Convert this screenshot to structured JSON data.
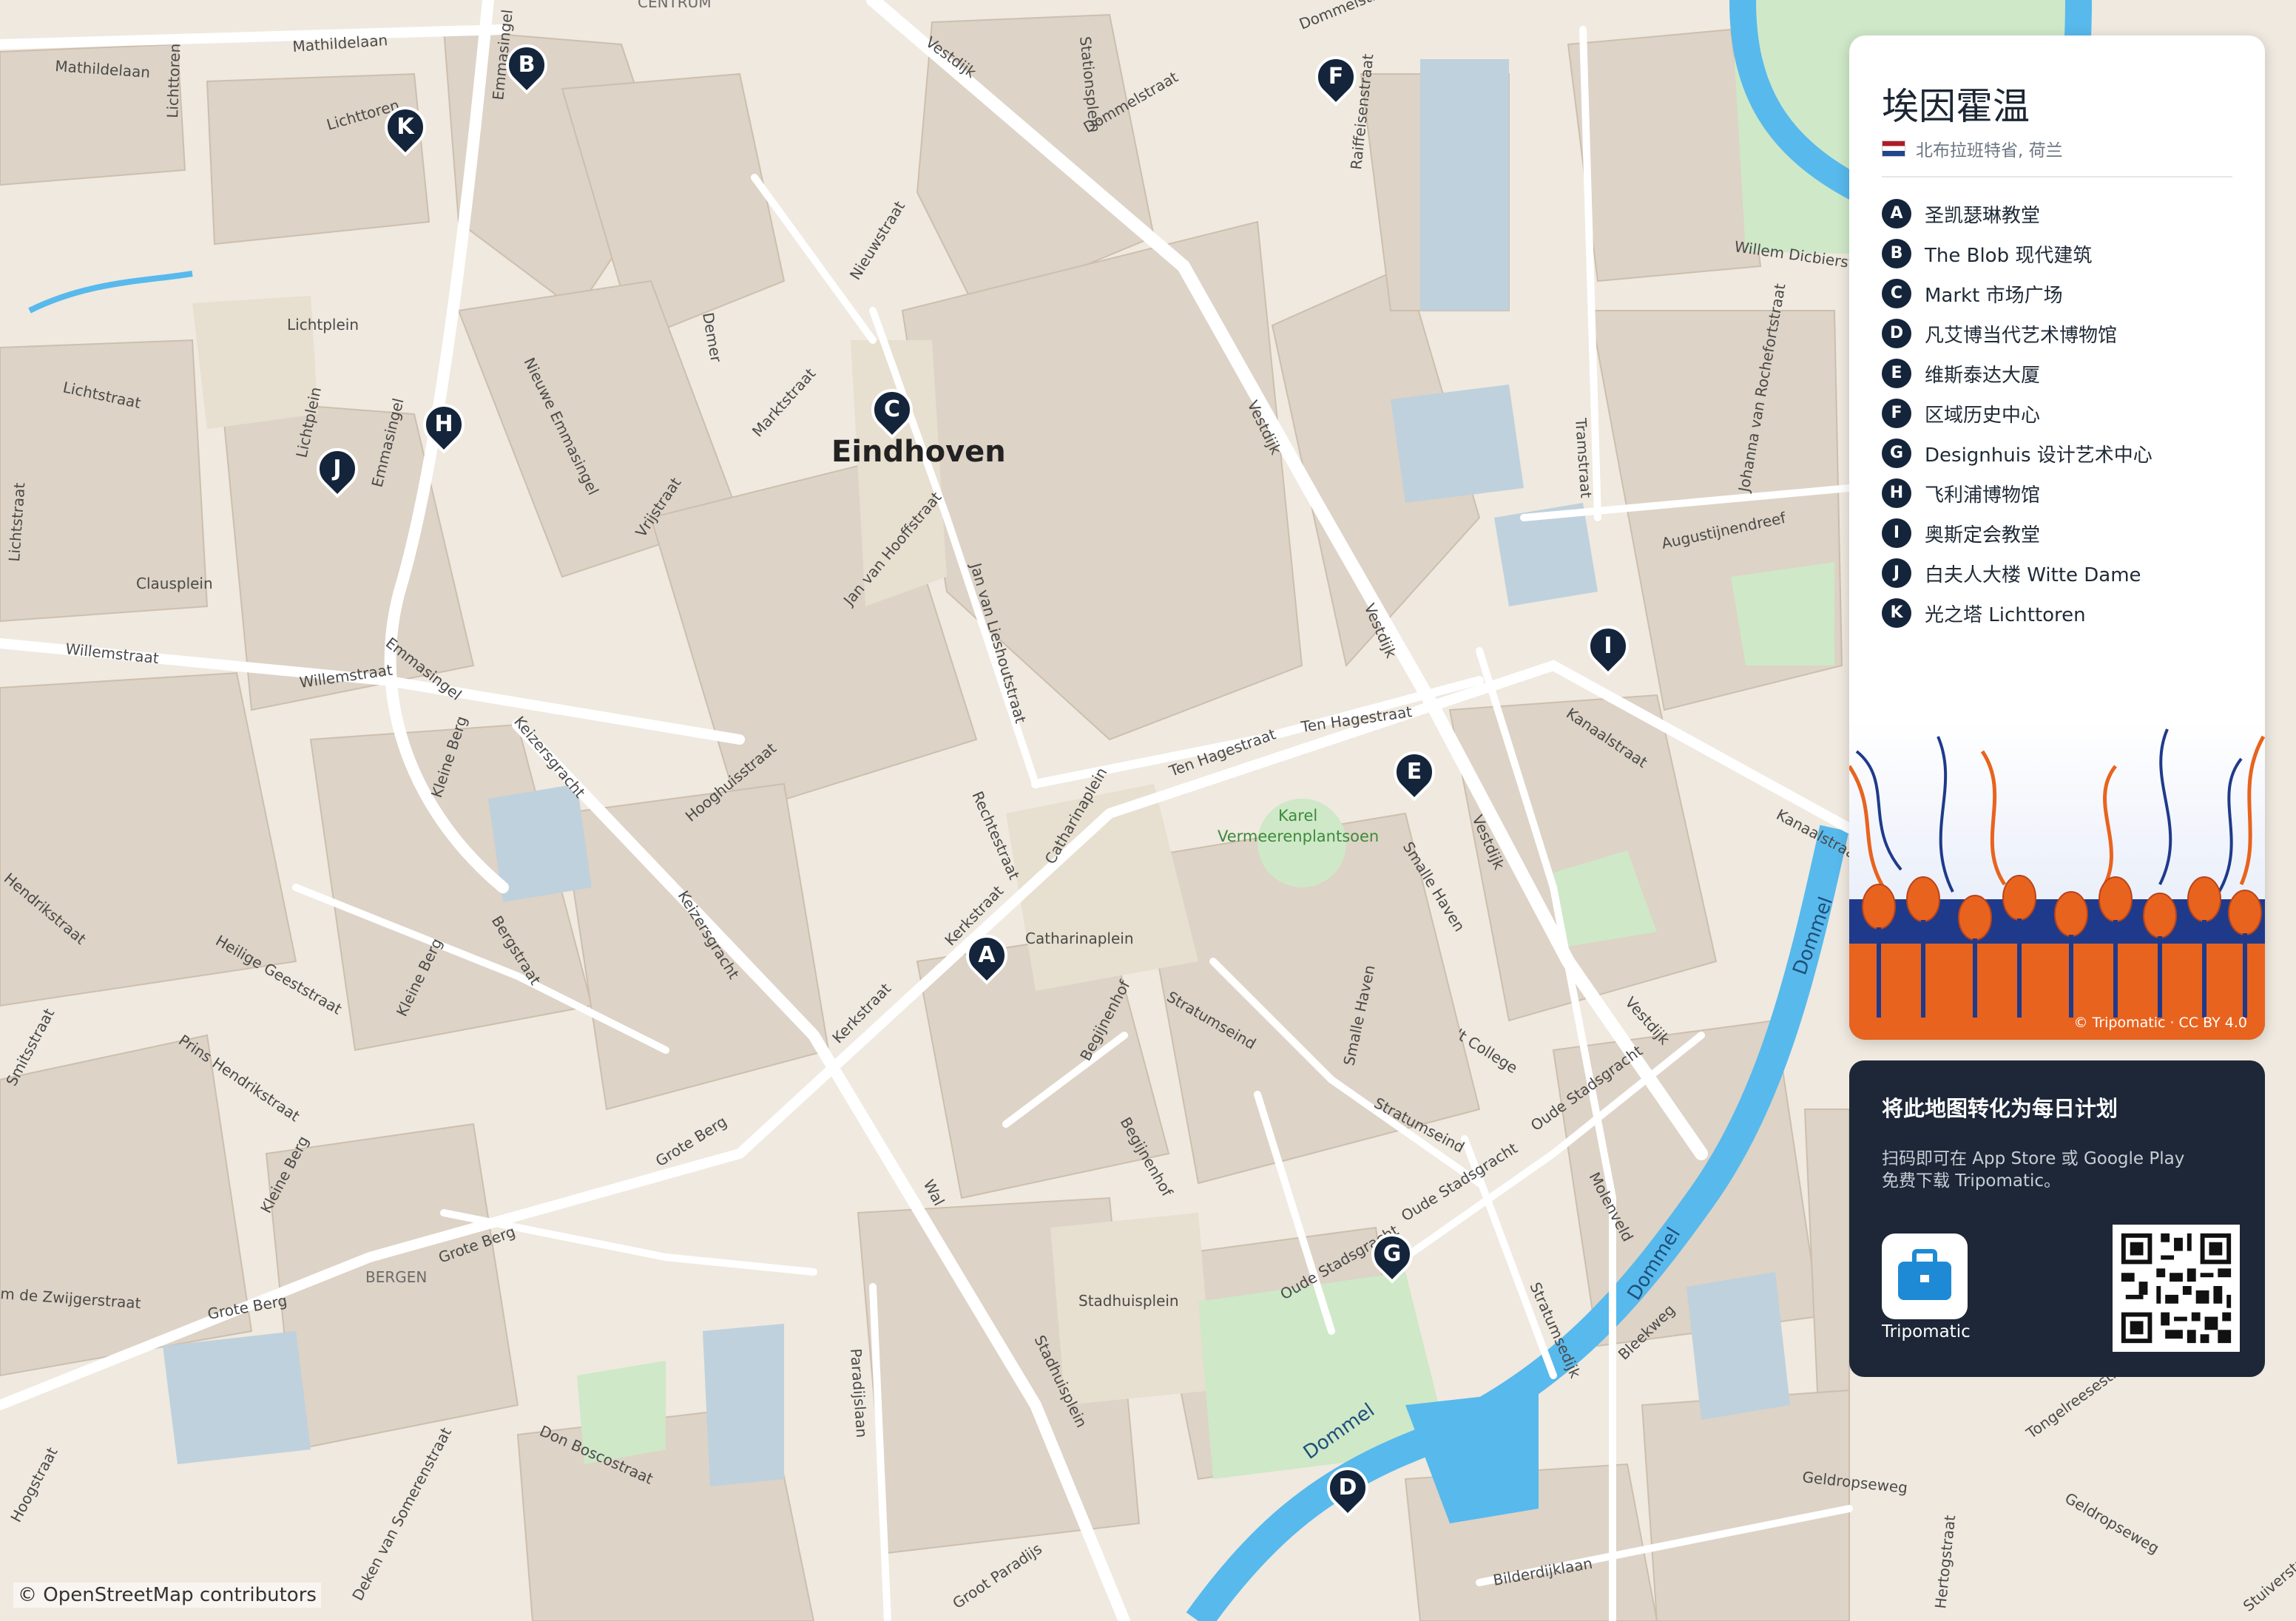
{
  "map": {
    "city_label": "Eindhoven",
    "attribution": "© OpenStreetMap contributors",
    "area_labels": [
      "CENTRUM",
      "BERGEN"
    ],
    "place_labels": [
      "Lichtplein",
      "Clausplein",
      "Karel",
      "Vermeerenplantsoen",
      "Catharinaplein",
      "Stadhuisplein"
    ],
    "water_labels": [
      "Dommel",
      "Dommel",
      "Dommel"
    ],
    "street_labels": [
      "Mathildelaan",
      "Mathildelaan",
      "Lichttoren",
      "Lichttoren",
      "Emmasingel",
      "Stationsplein",
      "Dommelstraat",
      "Dommelstraat",
      "Raiffeisenstraat",
      "Vestdijk",
      "Vestdijk",
      "Vestdijk",
      "Vestdijk",
      "Vestdijk",
      "Nieuwstraat",
      "Demer",
      "Marktstraat",
      "Nieuwe Emmasingel",
      "Lichtstraat",
      "Lichtplein",
      "Emmasingel",
      "Vrijstraat",
      "Jan van Hooffstraat",
      "Jan van Lieshoutstraat",
      "Willemstraat",
      "Willemstraat",
      "Emmasingel",
      "Keizersgracht",
      "Keizersgracht",
      "Hooghuisstraat",
      "Rechtestraat",
      "Catharinaplein",
      "Ten Hagestraat",
      "Ten Hagestraat",
      "Kleine Berg",
      "Kleine Berg",
      "Kleine Berg",
      "Bergstraat",
      "Heilige Geeststraat",
      "Hendrikstraat",
      "Prins Hendrikstraat",
      "Smitsstraat",
      "Kerkstraat",
      "Kerkstraat",
      "Grote Berg",
      "Grote Berg",
      "Grote Berg",
      "Wal",
      "Stratumseind",
      "Stratumseind",
      "Begijnenhof",
      "Begijnenhof",
      "Smalle Haven",
      "Smalle Haven",
      "Kanaalstraat",
      "Kanaalstraat",
      "Tramstraat",
      "Johanna van Rochefortstraat",
      "Augustijnendreef",
      "Willem Dicbierstraat",
      "'t College",
      "Oude Stadsgracht",
      "Oude Stadsgracht",
      "Oude Stadsgracht",
      "Molenveld",
      "Stratumsedijk",
      "Bleekweg",
      "Paradijslaan",
      "Stadhuisplein",
      "Don Boscostraat",
      "Deken van Somerenstraat",
      "Groot Paradijs",
      "Hoogstraat",
      "Bilderdijklaan",
      "Geldropseweg",
      "Geldropseweg",
      "Tongelreesestraat",
      "Hertogstraat",
      "Stuiverstraat",
      "m de Zwijgerstraat",
      "Lichtstraat"
    ],
    "markers": [
      {
        "letter": "A"
      },
      {
        "letter": "B"
      },
      {
        "letter": "C"
      },
      {
        "letter": "D"
      },
      {
        "letter": "E"
      },
      {
        "letter": "F"
      },
      {
        "letter": "G"
      },
      {
        "letter": "H"
      },
      {
        "letter": "I"
      },
      {
        "letter": "J"
      },
      {
        "letter": "K"
      }
    ]
  },
  "panel": {
    "title": "埃因霍温",
    "subtitle": "北布拉班特省, 荷兰",
    "flag_icon": "netherlands-flag-icon",
    "pois": [
      {
        "letter": "A",
        "name": "圣凯瑟琳教堂"
      },
      {
        "letter": "B",
        "name": "The Blob 现代建筑"
      },
      {
        "letter": "C",
        "name": "Markt 市场广场"
      },
      {
        "letter": "D",
        "name": "凡艾博当代艺术博物馆"
      },
      {
        "letter": "E",
        "name": "维斯泰达大厦"
      },
      {
        "letter": "F",
        "name": "区域历史中心"
      },
      {
        "letter": "G",
        "name": "Designhuis 设计艺术中心"
      },
      {
        "letter": "H",
        "name": "飞利浦博物馆"
      },
      {
        "letter": "I",
        "name": "奥斯定会教堂"
      },
      {
        "letter": "J",
        "name": "白夫人大楼 Witte Dame"
      },
      {
        "letter": "K",
        "name": "光之塔 Lichttoren"
      }
    ],
    "art_credit": "© Tripomatic · CC BY 4.0"
  },
  "promo": {
    "heading": "将此地图转化为每日计划",
    "text_line1": "扫码即可在 App Store 或 Google Play",
    "text_line2": "免费下载 Tripomatic。",
    "app_name": "Tripomatic",
    "app_icon": "suitcase-icon",
    "qr_icon": "qr-code-icon"
  },
  "colors": {
    "marker": "#14243a",
    "water": "#58b9ec",
    "building": "#ddd3c6",
    "park": "#cfe8c8",
    "promo_bg": "#1d2737",
    "tulip": "#e8631e"
  }
}
